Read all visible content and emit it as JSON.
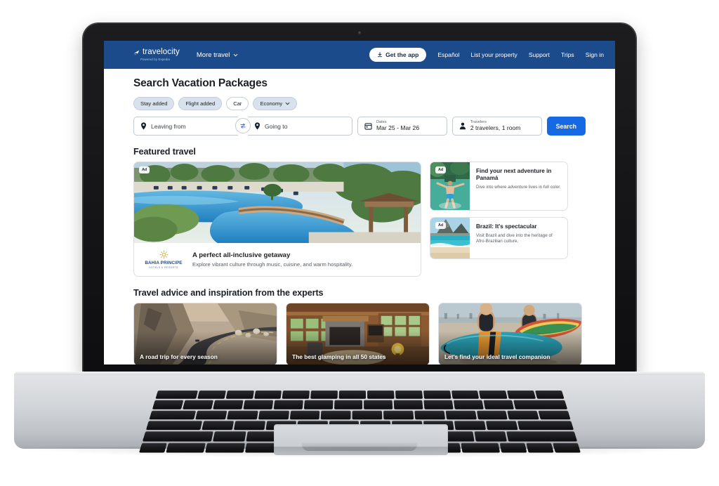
{
  "device": {
    "type": "laptop-mockup"
  },
  "header": {
    "brand_name": "travelocity",
    "brand_sub": "Powered by Expedia",
    "more_travel": "More travel",
    "get_the_app": "Get the app",
    "links": [
      "Español",
      "List your property",
      "Support",
      "Trips",
      "Sign in"
    ],
    "bg_color": "#1c4b8b"
  },
  "search": {
    "title": "Search Vacation Packages",
    "chips": [
      {
        "label": "Stay added",
        "style": "filled"
      },
      {
        "label": "Flight added",
        "style": "filled"
      },
      {
        "label": "Car",
        "style": "outline"
      },
      {
        "label": "Economy",
        "style": "filled",
        "caret": true
      }
    ],
    "leaving_from_placeholder": "Leaving from",
    "going_to_placeholder": "Going to",
    "dates_label": "Dates",
    "dates_value": "Mar 25 - Mar 26",
    "travelers_label": "Travelers",
    "travelers_value": "2 travelers, 1 room",
    "search_button": "Search",
    "accent_color": "#1668e3"
  },
  "featured": {
    "section_title": "Featured travel",
    "hero": {
      "ad_badge": "Ad",
      "brand_name": "BAHIA PRINCIPE",
      "brand_sub": "HOTELS & RESORTS",
      "title": "A perfect all-inclusive getaway",
      "description": "Explore vibrant culture through music, cuisine, and warm hospitality.",
      "image_alt": "resort-pool-aerial"
    },
    "cards": [
      {
        "ad_badge": "Ad",
        "title": "Find your next adventure in Panamá",
        "description": "Dive into where adventure lives in full color.",
        "image_alt": "person-jumping-into-pool"
      },
      {
        "ad_badge": "Ad",
        "title": "Brazil: It's spectacular",
        "description": "Visit Brazil and dive into the heritage of Afro-Brazilian culture.",
        "image_alt": "rio-beach-mountain"
      }
    ]
  },
  "advice": {
    "section_title": "Travel advice and inspiration from the experts",
    "cards": [
      {
        "caption": "A road trip for every season",
        "image_alt": "winding-canyon-road"
      },
      {
        "caption": "The best glamping in all 50 states",
        "image_alt": "rustic-cabin-interior"
      },
      {
        "caption": "Let's find your ideal travel companion",
        "image_alt": "surfers-with-surfboards"
      }
    ]
  }
}
